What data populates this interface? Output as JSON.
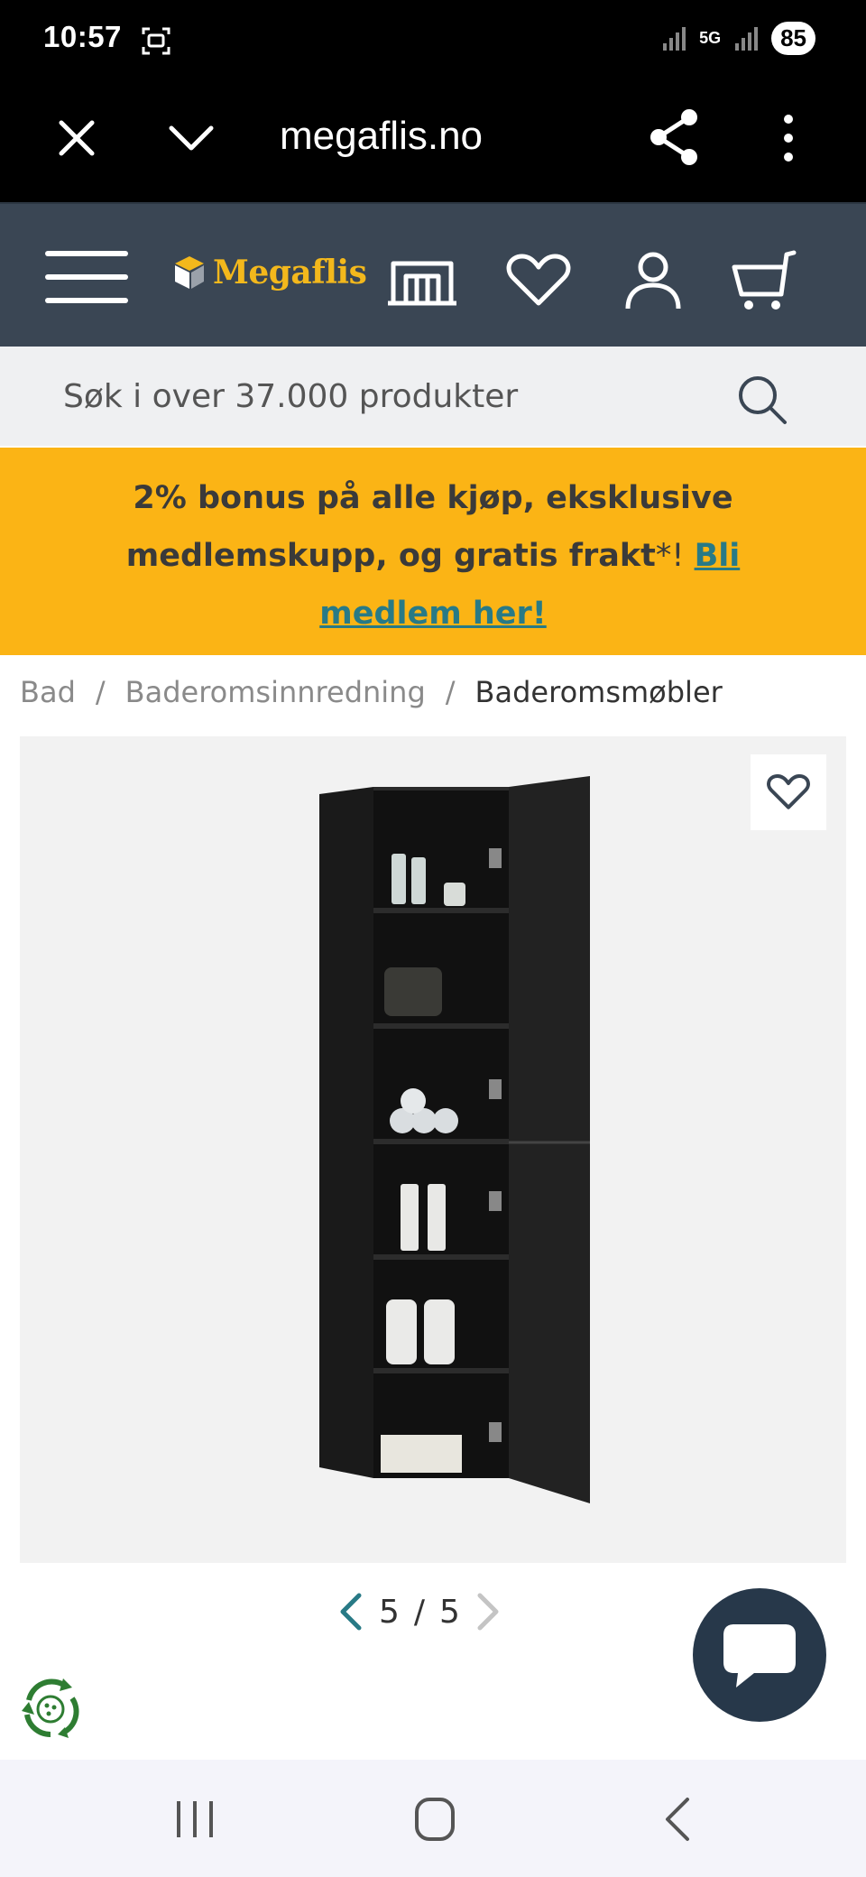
{
  "status_bar": {
    "time": "10:57",
    "network": "5G",
    "battery": "85"
  },
  "browser": {
    "url": "megaflis.no"
  },
  "header": {
    "logo_text": "Megaflis",
    "brand_color": "#f3b81c",
    "background_color": "#3a4654"
  },
  "search": {
    "placeholder": "Søk i over 37.000 produkter"
  },
  "promo": {
    "text": "2% bonus på alle kjøp, eksklusive medlemskupp, og gratis frakt",
    "asterisk": "*! ",
    "link_text": "Bli medlem her!",
    "background_color": "#fbb415"
  },
  "breadcrumb": {
    "items": [
      "Bad",
      "Baderomsinnredning",
      "Baderomsmøbler"
    ],
    "separator": "/"
  },
  "pager": {
    "current": "5",
    "separator": "/",
    "total": "5"
  }
}
